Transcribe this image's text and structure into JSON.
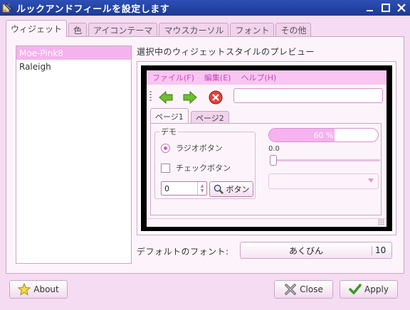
{
  "window": {
    "title": "ルックアンドフィールを設定します"
  },
  "tabs": [
    "ウィジェット",
    "色",
    "アイコンテーマ",
    "マウスカーソル",
    "フォント",
    "その他"
  ],
  "themes": {
    "items": [
      "Moe-Pink8",
      "Raleigh"
    ],
    "selected": "Moe-Pink8"
  },
  "preview": {
    "label": "選択中のウィジェットスタイルのプレビュー",
    "menu": [
      "ファイル(F)",
      "編集(E)",
      "ヘルプ(H)"
    ],
    "entry_value": "",
    "page_tabs": [
      "ページ1",
      "ページ2"
    ],
    "demo": {
      "legend": "デモ",
      "radio_label": "ラジオボタン",
      "check_label": "チェックボタン",
      "spin_value": "0",
      "button_label": "ボタン"
    },
    "progress_text": "60 %",
    "progress_fraction": 0.6,
    "scale_value": "0.0",
    "combo_value": ""
  },
  "font": {
    "label": "デフォルトのフォント:",
    "name": "あくびん",
    "size": "10"
  },
  "buttons": {
    "about": "About",
    "close": "Close",
    "apply": "Apply"
  },
  "colors": {
    "accent": "#f6b2ee",
    "titlebar": "#2d4fb6",
    "menu_text": "#c847b6"
  }
}
